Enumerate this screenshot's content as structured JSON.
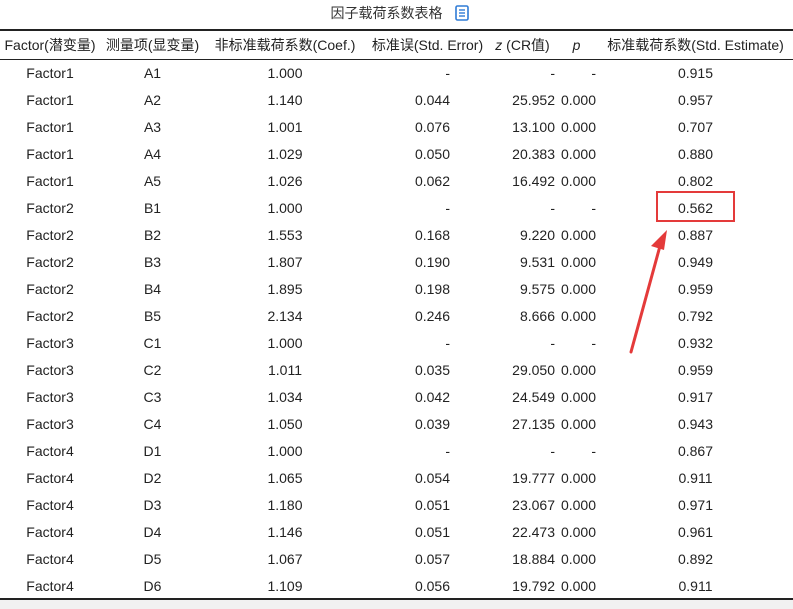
{
  "title": "因子载荷系数表格",
  "columns": {
    "factor": "Factor(潜变量)",
    "item": "测量项(显变量)",
    "coef": "非标准载荷系数(Coef.)",
    "se": "标准误(Std. Error)",
    "z_var": "z",
    "z_rest": " (CR值)",
    "p": "p",
    "std": "标准载荷系数(Std. Estimate)"
  },
  "rows": [
    {
      "factor": "Factor1",
      "item": "A1",
      "coef": "1.000",
      "se": "-",
      "z": "-",
      "p": "-",
      "std": "0.915"
    },
    {
      "factor": "Factor1",
      "item": "A2",
      "coef": "1.140",
      "se": "0.044",
      "z": "25.952",
      "p": "0.000",
      "std": "0.957"
    },
    {
      "factor": "Factor1",
      "item": "A3",
      "coef": "1.001",
      "se": "0.076",
      "z": "13.100",
      "p": "0.000",
      "std": "0.707"
    },
    {
      "factor": "Factor1",
      "item": "A4",
      "coef": "1.029",
      "se": "0.050",
      "z": "20.383",
      "p": "0.000",
      "std": "0.880"
    },
    {
      "factor": "Factor1",
      "item": "A5",
      "coef": "1.026",
      "se": "0.062",
      "z": "16.492",
      "p": "0.000",
      "std": "0.802"
    },
    {
      "factor": "Factor2",
      "item": "B1",
      "coef": "1.000",
      "se": "-",
      "z": "-",
      "p": "-",
      "std": "0.562"
    },
    {
      "factor": "Factor2",
      "item": "B2",
      "coef": "1.553",
      "se": "0.168",
      "z": "9.220",
      "p": "0.000",
      "std": "0.887"
    },
    {
      "factor": "Factor2",
      "item": "B3",
      "coef": "1.807",
      "se": "0.190",
      "z": "9.531",
      "p": "0.000",
      "std": "0.949"
    },
    {
      "factor": "Factor2",
      "item": "B4",
      "coef": "1.895",
      "se": "0.198",
      "z": "9.575",
      "p": "0.000",
      "std": "0.959"
    },
    {
      "factor": "Factor2",
      "item": "B5",
      "coef": "2.134",
      "se": "0.246",
      "z": "8.666",
      "p": "0.000",
      "std": "0.792"
    },
    {
      "factor": "Factor3",
      "item": "C1",
      "coef": "1.000",
      "se": "-",
      "z": "-",
      "p": "-",
      "std": "0.932"
    },
    {
      "factor": "Factor3",
      "item": "C2",
      "coef": "1.011",
      "se": "0.035",
      "z": "29.050",
      "p": "0.000",
      "std": "0.959"
    },
    {
      "factor": "Factor3",
      "item": "C3",
      "coef": "1.034",
      "se": "0.042",
      "z": "24.549",
      "p": "0.000",
      "std": "0.917"
    },
    {
      "factor": "Factor3",
      "item": "C4",
      "coef": "1.050",
      "se": "0.039",
      "z": "27.135",
      "p": "0.000",
      "std": "0.943"
    },
    {
      "factor": "Factor4",
      "item": "D1",
      "coef": "1.000",
      "se": "-",
      "z": "-",
      "p": "-",
      "std": "0.867"
    },
    {
      "factor": "Factor4",
      "item": "D2",
      "coef": "1.065",
      "se": "0.054",
      "z": "19.777",
      "p": "0.000",
      "std": "0.911"
    },
    {
      "factor": "Factor4",
      "item": "D3",
      "coef": "1.180",
      "se": "0.051",
      "z": "23.067",
      "p": "0.000",
      "std": "0.971"
    },
    {
      "factor": "Factor4",
      "item": "D4",
      "coef": "1.146",
      "se": "0.051",
      "z": "22.473",
      "p": "0.000",
      "std": "0.961"
    },
    {
      "factor": "Factor4",
      "item": "D5",
      "coef": "1.067",
      "se": "0.057",
      "z": "18.884",
      "p": "0.000",
      "std": "0.892"
    },
    {
      "factor": "Factor4",
      "item": "D6",
      "coef": "1.109",
      "se": "0.056",
      "z": "19.792",
      "p": "0.000",
      "std": "0.911"
    }
  ],
  "colors": {
    "highlight": "#e43a3a",
    "icon": "#2f7bd6",
    "rule": "#222222"
  },
  "icons": {
    "copy": "copy-icon"
  }
}
